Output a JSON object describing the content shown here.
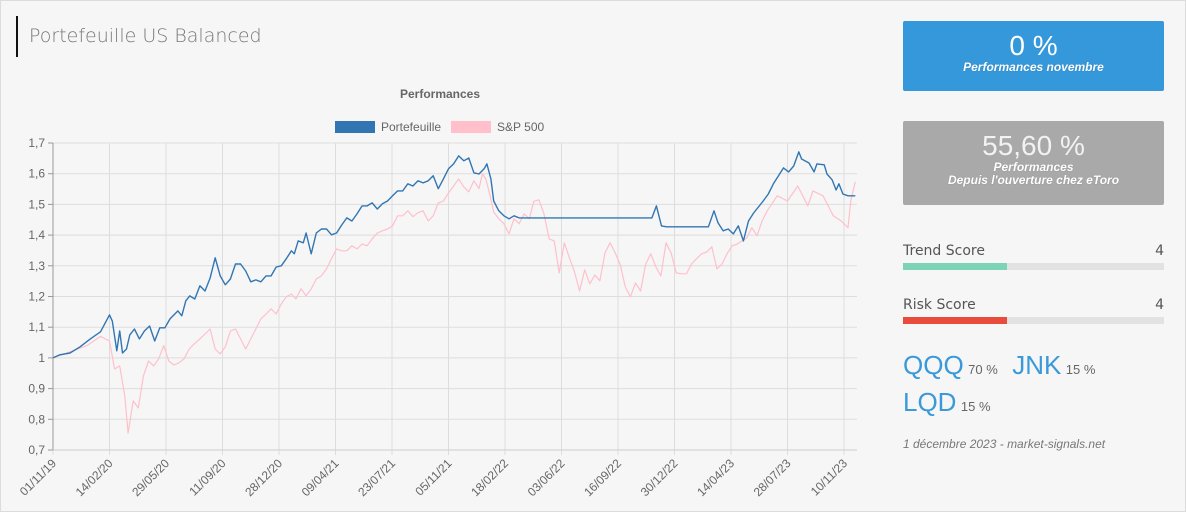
{
  "page": {
    "title": "Portefeuille US Balanced"
  },
  "chart_data": {
    "type": "line",
    "title": "Performances",
    "xlabel": "",
    "ylabel": "",
    "ylim": [
      0.7,
      1.7
    ],
    "yticks": [
      "1,7",
      "1,6",
      "1,5",
      "1,4",
      "1,3",
      "1,2",
      "1,1",
      "1",
      "0,9",
      "0,8",
      "0,7"
    ],
    "ytick_values": [
      1.7,
      1.6,
      1.5,
      1.4,
      1.3,
      1.2,
      1.1,
      1.0,
      0.9,
      0.8,
      0.7
    ],
    "xticks": [
      "01/11/19",
      "14/02/20",
      "29/05/20",
      "11/09/20",
      "28/12/20",
      "09/04/21",
      "23/07/21",
      "05/11/21",
      "18/02/22",
      "03/06/22",
      "16/09/22",
      "30/12/22",
      "14/04/23",
      "28/07/23",
      "10/11/23"
    ],
    "x_range_ticks": [
      0,
      14.2
    ],
    "grid": true,
    "legend_position": "top-center",
    "series": [
      {
        "name": "Portefeuille",
        "color": "#3176b3",
        "points": [
          [
            0,
            1.0
          ],
          [
            0.12,
            1.01
          ],
          [
            0.3,
            1.016
          ],
          [
            0.48,
            1.036
          ],
          [
            0.66,
            1.062
          ],
          [
            0.84,
            1.085
          ],
          [
            1.0,
            1.14
          ],
          [
            1.05,
            1.12
          ],
          [
            1.13,
            1.023
          ],
          [
            1.18,
            1.088
          ],
          [
            1.23,
            1.016
          ],
          [
            1.3,
            1.029
          ],
          [
            1.36,
            1.075
          ],
          [
            1.44,
            1.094
          ],
          [
            1.53,
            1.062
          ],
          [
            1.62,
            1.088
          ],
          [
            1.71,
            1.104
          ],
          [
            1.8,
            1.055
          ],
          [
            1.89,
            1.098
          ],
          [
            1.98,
            1.098
          ],
          [
            2.07,
            1.127
          ],
          [
            2.21,
            1.153
          ],
          [
            2.28,
            1.137
          ],
          [
            2.35,
            1.186
          ],
          [
            2.42,
            1.202
          ],
          [
            2.51,
            1.192
          ],
          [
            2.6,
            1.235
          ],
          [
            2.69,
            1.218
          ],
          [
            2.78,
            1.26
          ],
          [
            2.87,
            1.326
          ],
          [
            2.96,
            1.267
          ],
          [
            3.05,
            1.238
          ],
          [
            3.14,
            1.257
          ],
          [
            3.23,
            1.306
          ],
          [
            3.32,
            1.306
          ],
          [
            3.41,
            1.283
          ],
          [
            3.5,
            1.248
          ],
          [
            3.59,
            1.254
          ],
          [
            3.68,
            1.248
          ],
          [
            3.77,
            1.267
          ],
          [
            3.86,
            1.267
          ],
          [
            3.95,
            1.296
          ],
          [
            4.04,
            1.3
          ],
          [
            4.13,
            1.323
          ],
          [
            4.22,
            1.349
          ],
          [
            4.27,
            1.339
          ],
          [
            4.34,
            1.381
          ],
          [
            4.43,
            1.375
          ],
          [
            4.48,
            1.407
          ],
          [
            4.57,
            1.339
          ],
          [
            4.66,
            1.407
          ],
          [
            4.75,
            1.42
          ],
          [
            4.84,
            1.42
          ],
          [
            4.93,
            1.401
          ],
          [
            5.02,
            1.407
          ],
          [
            5.11,
            1.433
          ],
          [
            5.2,
            1.456
          ],
          [
            5.29,
            1.446
          ],
          [
            5.38,
            1.469
          ],
          [
            5.47,
            1.495
          ],
          [
            5.56,
            1.495
          ],
          [
            5.65,
            1.505
          ],
          [
            5.74,
            1.485
          ],
          [
            5.83,
            1.502
          ],
          [
            5.92,
            1.511
          ],
          [
            6.01,
            1.528
          ],
          [
            6.1,
            1.544
          ],
          [
            6.19,
            1.544
          ],
          [
            6.28,
            1.567
          ],
          [
            6.37,
            1.56
          ],
          [
            6.46,
            1.577
          ],
          [
            6.55,
            1.57
          ],
          [
            6.64,
            1.577
          ],
          [
            6.73,
            1.593
          ],
          [
            6.82,
            1.551
          ],
          [
            6.91,
            1.583
          ],
          [
            7.0,
            1.616
          ],
          [
            7.09,
            1.632
          ],
          [
            7.18,
            1.658
          ],
          [
            7.27,
            1.642
          ],
          [
            7.36,
            1.651
          ],
          [
            7.45,
            1.603
          ],
          [
            7.54,
            1.599
          ],
          [
            7.63,
            1.616
          ],
          [
            7.68,
            1.632
          ],
          [
            7.75,
            1.583
          ],
          [
            7.8,
            1.511
          ],
          [
            7.89,
            1.479
          ],
          [
            7.98,
            1.463
          ],
          [
            8.07,
            1.453
          ],
          [
            8.16,
            1.463
          ],
          [
            8.25,
            1.456
          ],
          [
            8.4,
            1.456
          ],
          [
            10.6,
            1.456
          ],
          [
            10.68,
            1.495
          ],
          [
            10.77,
            1.43
          ],
          [
            10.86,
            1.427
          ],
          [
            11.6,
            1.427
          ],
          [
            11.7,
            1.479
          ],
          [
            11.77,
            1.44
          ],
          [
            11.86,
            1.414
          ],
          [
            11.95,
            1.42
          ],
          [
            12.04,
            1.404
          ],
          [
            12.13,
            1.43
          ],
          [
            12.22,
            1.381
          ],
          [
            12.31,
            1.446
          ],
          [
            12.4,
            1.472
          ],
          [
            12.57,
            1.511
          ],
          [
            12.66,
            1.534
          ],
          [
            12.75,
            1.567
          ],
          [
            12.84,
            1.593
          ],
          [
            12.93,
            1.619
          ],
          [
            13.02,
            1.606
          ],
          [
            13.11,
            1.625
          ],
          [
            13.2,
            1.671
          ],
          [
            13.25,
            1.648
          ],
          [
            13.38,
            1.635
          ],
          [
            13.47,
            1.606
          ],
          [
            13.52,
            1.632
          ],
          [
            13.65,
            1.629
          ],
          [
            13.7,
            1.599
          ],
          [
            13.79,
            1.58
          ],
          [
            13.86,
            1.547
          ],
          [
            13.91,
            1.567
          ],
          [
            13.98,
            1.534
          ],
          [
            14.07,
            1.528
          ],
          [
            14.2,
            1.528
          ]
        ]
      },
      {
        "name": "S&P 500",
        "color": "#ffc0cb",
        "points": [
          [
            0,
            1.0
          ],
          [
            0.3,
            1.02
          ],
          [
            0.6,
            1.04
          ],
          [
            0.84,
            1.07
          ],
          [
            1.0,
            1.055
          ],
          [
            1.09,
            0.964
          ],
          [
            1.18,
            0.974
          ],
          [
            1.27,
            0.876
          ],
          [
            1.33,
            0.755
          ],
          [
            1.42,
            0.86
          ],
          [
            1.51,
            0.837
          ],
          [
            1.6,
            0.941
          ],
          [
            1.69,
            0.99
          ],
          [
            1.78,
            0.974
          ],
          [
            1.87,
            0.997
          ],
          [
            1.96,
            1.04
          ],
          [
            2.05,
            0.99
          ],
          [
            2.14,
            0.977
          ],
          [
            2.23,
            0.984
          ],
          [
            2.32,
            0.997
          ],
          [
            2.41,
            1.029
          ],
          [
            2.5,
            1.046
          ],
          [
            2.6,
            1.062
          ],
          [
            2.69,
            1.078
          ],
          [
            2.78,
            1.094
          ],
          [
            2.87,
            1.029
          ],
          [
            2.96,
            1.013
          ],
          [
            3.05,
            1.036
          ],
          [
            3.14,
            1.088
          ],
          [
            3.23,
            1.094
          ],
          [
            3.32,
            1.062
          ],
          [
            3.41,
            1.029
          ],
          [
            3.5,
            1.062
          ],
          [
            3.59,
            1.094
          ],
          [
            3.68,
            1.127
          ],
          [
            3.77,
            1.143
          ],
          [
            3.86,
            1.16
          ],
          [
            3.95,
            1.143
          ],
          [
            4.04,
            1.176
          ],
          [
            4.13,
            1.199
          ],
          [
            4.22,
            1.208
          ],
          [
            4.3,
            1.192
          ],
          [
            4.39,
            1.225
          ],
          [
            4.48,
            1.202
          ],
          [
            4.57,
            1.225
          ],
          [
            4.66,
            1.257
          ],
          [
            4.75,
            1.267
          ],
          [
            4.84,
            1.29
          ],
          [
            4.93,
            1.323
          ],
          [
            5.02,
            1.355
          ],
          [
            5.11,
            1.349
          ],
          [
            5.2,
            1.349
          ],
          [
            5.29,
            1.365
          ],
          [
            5.38,
            1.355
          ],
          [
            5.47,
            1.371
          ],
          [
            5.56,
            1.365
          ],
          [
            5.65,
            1.388
          ],
          [
            5.74,
            1.407
          ],
          [
            5.83,
            1.414
          ],
          [
            5.92,
            1.42
          ],
          [
            6.01,
            1.43
          ],
          [
            6.1,
            1.463
          ],
          [
            6.19,
            1.463
          ],
          [
            6.28,
            1.479
          ],
          [
            6.37,
            1.46
          ],
          [
            6.46,
            1.473
          ],
          [
            6.55,
            1.479
          ],
          [
            6.64,
            1.446
          ],
          [
            6.73,
            1.463
          ],
          [
            6.82,
            1.505
          ],
          [
            6.91,
            1.511
          ],
          [
            7.0,
            1.537
          ],
          [
            7.09,
            1.56
          ],
          [
            7.18,
            1.583
          ],
          [
            7.27,
            1.557
          ],
          [
            7.36,
            1.541
          ],
          [
            7.45,
            1.577
          ],
          [
            7.54,
            1.551
          ],
          [
            7.6,
            1.599
          ],
          [
            7.66,
            1.583
          ],
          [
            7.73,
            1.534
          ],
          [
            7.8,
            1.475
          ],
          [
            7.89,
            1.453
          ],
          [
            7.98,
            1.437
          ],
          [
            8.07,
            1.404
          ],
          [
            8.16,
            1.453
          ],
          [
            8.25,
            1.437
          ],
          [
            8.34,
            1.469
          ],
          [
            8.43,
            1.453
          ],
          [
            8.51,
            1.51
          ],
          [
            8.6,
            1.515
          ],
          [
            8.69,
            1.469
          ],
          [
            8.78,
            1.388
          ],
          [
            8.87,
            1.381
          ],
          [
            8.96,
            1.277
          ],
          [
            9.05,
            1.375
          ],
          [
            9.14,
            1.326
          ],
          [
            9.23,
            1.28
          ],
          [
            9.32,
            1.218
          ],
          [
            9.41,
            1.287
          ],
          [
            9.5,
            1.241
          ],
          [
            9.59,
            1.27
          ],
          [
            9.68,
            1.251
          ],
          [
            9.77,
            1.342
          ],
          [
            9.86,
            1.375
          ],
          [
            9.95,
            1.342
          ],
          [
            10.04,
            1.303
          ],
          [
            10.13,
            1.231
          ],
          [
            10.22,
            1.199
          ],
          [
            10.31,
            1.244
          ],
          [
            10.4,
            1.218
          ],
          [
            10.49,
            1.306
          ],
          [
            10.58,
            1.339
          ],
          [
            10.67,
            1.296
          ],
          [
            10.76,
            1.267
          ],
          [
            10.85,
            1.375
          ],
          [
            10.94,
            1.342
          ],
          [
            11.03,
            1.277
          ],
          [
            11.12,
            1.274
          ],
          [
            11.21,
            1.274
          ],
          [
            11.3,
            1.306
          ],
          [
            11.39,
            1.323
          ],
          [
            11.48,
            1.339
          ],
          [
            11.57,
            1.345
          ],
          [
            11.66,
            1.362
          ],
          [
            11.75,
            1.29
          ],
          [
            11.84,
            1.306
          ],
          [
            11.93,
            1.339
          ],
          [
            12.02,
            1.365
          ],
          [
            12.11,
            1.371
          ],
          [
            12.28,
            1.391
          ],
          [
            12.37,
            1.424
          ],
          [
            12.46,
            1.398
          ],
          [
            12.55,
            1.446
          ],
          [
            12.64,
            1.479
          ],
          [
            12.82,
            1.528
          ],
          [
            13.0,
            1.511
          ],
          [
            13.18,
            1.56
          ],
          [
            13.27,
            1.528
          ],
          [
            13.36,
            1.495
          ],
          [
            13.45,
            1.544
          ],
          [
            13.63,
            1.528
          ],
          [
            13.72,
            1.495
          ],
          [
            13.81,
            1.463
          ],
          [
            13.95,
            1.446
          ],
          [
            14.07,
            1.424
          ],
          [
            14.12,
            1.512
          ],
          [
            14.2,
            1.574
          ]
        ]
      }
    ]
  },
  "cards": {
    "month": {
      "value": "0 %",
      "label": "Performances novembre",
      "color": "#3498db"
    },
    "total": {
      "value": "55,60 %",
      "label_line1": "Performances",
      "label_line2": "Depuis l'ouverture chez eToro",
      "color": "#a9a9a9"
    }
  },
  "scores": {
    "trend": {
      "label": "Trend Score",
      "value": "4",
      "fraction": 0.4,
      "color": "#7dd3b5"
    },
    "risk": {
      "label": "Risk Score",
      "value": "4",
      "fraction": 0.4,
      "color": "#e74c3c"
    }
  },
  "allocation": [
    {
      "symbol": "QQQ",
      "weight": "70 %"
    },
    {
      "symbol": "JNK",
      "weight": "15 %"
    },
    {
      "symbol": "LQD",
      "weight": "15 %"
    }
  ],
  "footer": "1 décembre 2023 - market-signals.net"
}
